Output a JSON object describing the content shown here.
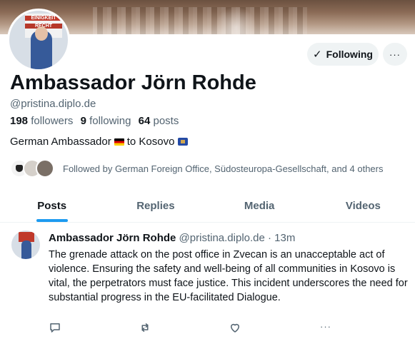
{
  "profile": {
    "display_name": "Ambassador Jörn Rohde",
    "handle": "@pristina.diplo.de",
    "followers_count": "198",
    "followers_label": "followers",
    "following_count": "9",
    "following_label": "following",
    "posts_count": "64",
    "posts_label": "posts",
    "bio_before": "German Ambassador",
    "bio_middle": "to Kosovo",
    "followed_by": "Followed by German Foreign Office, Südosteuropa-Gesellschaft, and 4 others",
    "avatar_sign_line1": "EINIGKEIT",
    "avatar_sign_line2": "RECHT"
  },
  "header": {
    "following_button": "Following",
    "more_button": "···"
  },
  "tabs": [
    {
      "label": "Posts",
      "active": true
    },
    {
      "label": "Replies",
      "active": false
    },
    {
      "label": "Media",
      "active": false
    },
    {
      "label": "Videos",
      "active": false
    }
  ],
  "post": {
    "author": "Ambassador Jörn Rohde",
    "meta": "@pristina.diplo.de · 13m",
    "text": "The grenade attack on the post office in Zvecan is an unacceptable act of violence. Ensuring the safety and well-being of all communities in Kosovo is vital, the perpetrators must face justice. This incident underscores the need for substantial progress in the EU-facilitated Dialogue.",
    "more_label": "···"
  },
  "icons": {
    "following_check": "check-icon",
    "reply": "reply-icon",
    "repost": "repost-icon",
    "like": "heart-icon",
    "more": "more-icon"
  },
  "colors": {
    "accent": "#1d9bf0",
    "text_primary": "#0f1419",
    "text_secondary": "#536471",
    "button_bg": "#eff3f4"
  }
}
